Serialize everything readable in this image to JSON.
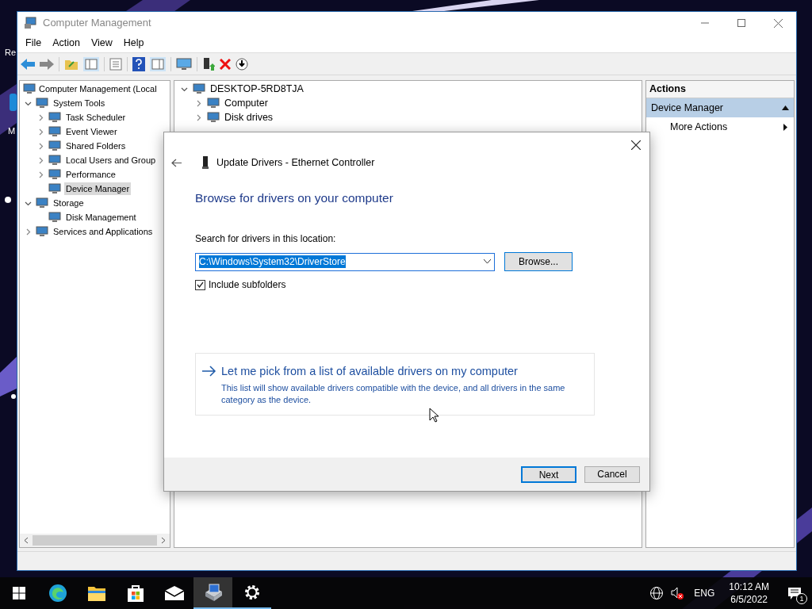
{
  "desktop": {
    "icon_labels": [
      "Re",
      "M"
    ]
  },
  "window": {
    "title": "Computer Management"
  },
  "menu": [
    "File",
    "Action",
    "View",
    "Help"
  ],
  "tree": [
    {
      "label": "Computer Management (Local",
      "selected": false,
      "children": [
        {
          "label": "System Tools",
          "selected": false,
          "expanded": true,
          "children": [
            {
              "label": "Task Scheduler",
              "selected": false,
              "expanded": false
            },
            {
              "label": "Event Viewer",
              "selected": false,
              "expanded": false
            },
            {
              "label": "Shared Folders",
              "selected": false,
              "expanded": false
            },
            {
              "label": "Local Users and Group",
              "selected": false,
              "expanded": false
            },
            {
              "label": "Performance",
              "selected": false,
              "expanded": false
            },
            {
              "label": "Device Manager",
              "selected": true
            }
          ]
        },
        {
          "label": "Storage",
          "selected": false,
          "expanded": true,
          "children": [
            {
              "label": "Disk Management",
              "selected": false
            }
          ]
        },
        {
          "label": "Services and Applications",
          "selected": false,
          "expanded": false
        }
      ]
    }
  ],
  "devices": {
    "root": "DESKTOP-5RD8TJA",
    "expanded": true,
    "items": [
      "Computer",
      "Disk drives"
    ]
  },
  "actions": {
    "title": "Actions",
    "section": "Device Manager",
    "items": [
      "More Actions"
    ]
  },
  "dialog": {
    "title": "Update Drivers - Ethernet Controller",
    "heading": "Browse for drivers on your computer",
    "location_label": "Search for drivers in this location:",
    "location_value": "C:\\Windows\\System32\\DriverStore",
    "browse": "Browse...",
    "include_subfolders": {
      "label": "Include subfolders",
      "checked": true
    },
    "pick": {
      "title": "Let me pick from a list of available drivers on my computer",
      "description": "This list will show available drivers compatible with the device, and all drivers in the same category as the device."
    },
    "buttons": [
      {
        "label": "Next",
        "default": true
      },
      {
        "label": "Cancel",
        "default": false
      }
    ]
  },
  "taskbar": {
    "apps": [
      {
        "kind": "edge",
        "active": false
      },
      {
        "kind": "explorer",
        "active": false
      },
      {
        "kind": "store",
        "active": false
      },
      {
        "kind": "mail",
        "active": false
      },
      {
        "kind": "computer",
        "active": true
      },
      {
        "kind": "settings",
        "active": true
      }
    ],
    "language": "ENG",
    "time": "10:12 AM",
    "date": "6/5/2022",
    "notifications": "1"
  }
}
